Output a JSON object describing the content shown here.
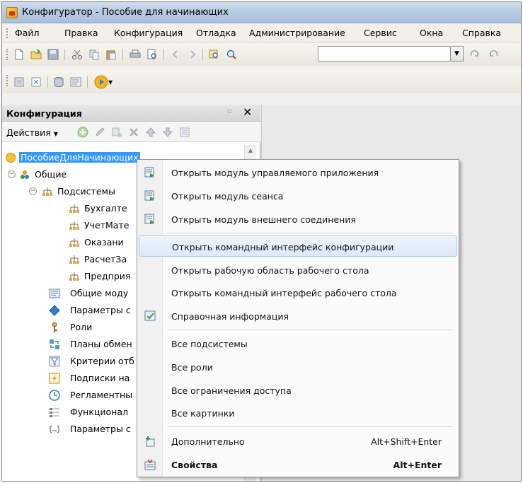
{
  "window": {
    "title": "Конфигуратор - Пособие для начинающих"
  },
  "menubar": {
    "items": [
      "Файл",
      "Правка",
      "Конфигурация",
      "Отладка",
      "Администрирование",
      "Сервис",
      "Окна",
      "Справка"
    ]
  },
  "toolbar": {
    "search_value": "",
    "icons": [
      "new-document-icon",
      "open-folder-icon",
      "save-icon",
      "cut-icon",
      "copy-icon",
      "paste-icon",
      "print-icon",
      "print-preview-icon",
      "back-arrow-icon",
      "forward-arrow-icon",
      "find-in-folder-icon",
      "search-icon",
      "dropdown-icon",
      "search-next-icon",
      "search-prev-icon"
    ]
  },
  "toolbar2": {
    "icons": [
      "database-icon",
      "config-compare-icon",
      "db-update-icon",
      "module-icon",
      "run-debug-icon"
    ]
  },
  "panel": {
    "title": "Конфигурация",
    "actions_label": "Действия",
    "tree": [
      {
        "label": "ПособиеДляНачинающих",
        "icon": "config-root-icon"
      },
      {
        "label": "Общие",
        "icon": "common-icon"
      },
      {
        "label": "Подсистемы",
        "icon": "subsystems-icon"
      },
      {
        "label": "Бухгалте",
        "icon": "subsystem-icon"
      },
      {
        "label": "УчетМате",
        "icon": "subsystem-icon"
      },
      {
        "label": "Оказани",
        "icon": "subsystem-icon"
      },
      {
        "label": "РасчетЗа",
        "icon": "subsystem-icon"
      },
      {
        "label": "Предприя",
        "icon": "subsystem-icon"
      },
      {
        "label": "Общие моду",
        "icon": "common-modules-icon"
      },
      {
        "label": "Параметры с",
        "icon": "session-params-icon"
      },
      {
        "label": "Роли",
        "icon": "roles-icon"
      },
      {
        "label": "Планы обмен",
        "icon": "exchange-plans-icon"
      },
      {
        "label": "Критерии отб",
        "icon": "filter-criteria-icon"
      },
      {
        "label": "Подписки на",
        "icon": "event-subscriptions-icon"
      },
      {
        "label": "Регламентны",
        "icon": "scheduled-jobs-icon"
      },
      {
        "label": "Функционал",
        "icon": "functional-options-icon"
      },
      {
        "label": "Параметры с",
        "icon": "params-icon"
      }
    ]
  },
  "context_menu": {
    "items": [
      {
        "label": "Открыть модуль управляемого приложения",
        "icon": "module-open-icon",
        "shortcut": ""
      },
      {
        "label": "Открыть модуль сеанса",
        "icon": "module-open-icon",
        "shortcut": ""
      },
      {
        "label": "Открыть модуль внешнего соединения",
        "icon": "module-open-icon",
        "shortcut": ""
      },
      {
        "label": "Открыть командный интерфейс конфигурации",
        "icon": "",
        "shortcut": ""
      },
      {
        "label": "Открыть рабочую область рабочего стола",
        "icon": "",
        "shortcut": ""
      },
      {
        "label": "Открыть командный интерфейс рабочего стола",
        "icon": "",
        "shortcut": ""
      },
      {
        "label": "Справочная информация",
        "icon": "help-info-icon",
        "shortcut": ""
      },
      {
        "label": "Все подсистемы",
        "icon": "",
        "shortcut": ""
      },
      {
        "label": "Все роли",
        "icon": "",
        "shortcut": ""
      },
      {
        "label": "Все ограничения доступа",
        "icon": "",
        "shortcut": ""
      },
      {
        "label": "Все картинки",
        "icon": "",
        "shortcut": ""
      },
      {
        "label": "Дополнительно",
        "icon": "additional-icon",
        "shortcut": "Alt+Shift+Enter"
      },
      {
        "label": "Свойства",
        "icon": "properties-icon",
        "shortcut": "Alt+Enter"
      }
    ]
  },
  "colors": {
    "titlebar": "#b9cce4",
    "highlight": "#3399ff",
    "menu_hover": "#dbe9f9"
  }
}
